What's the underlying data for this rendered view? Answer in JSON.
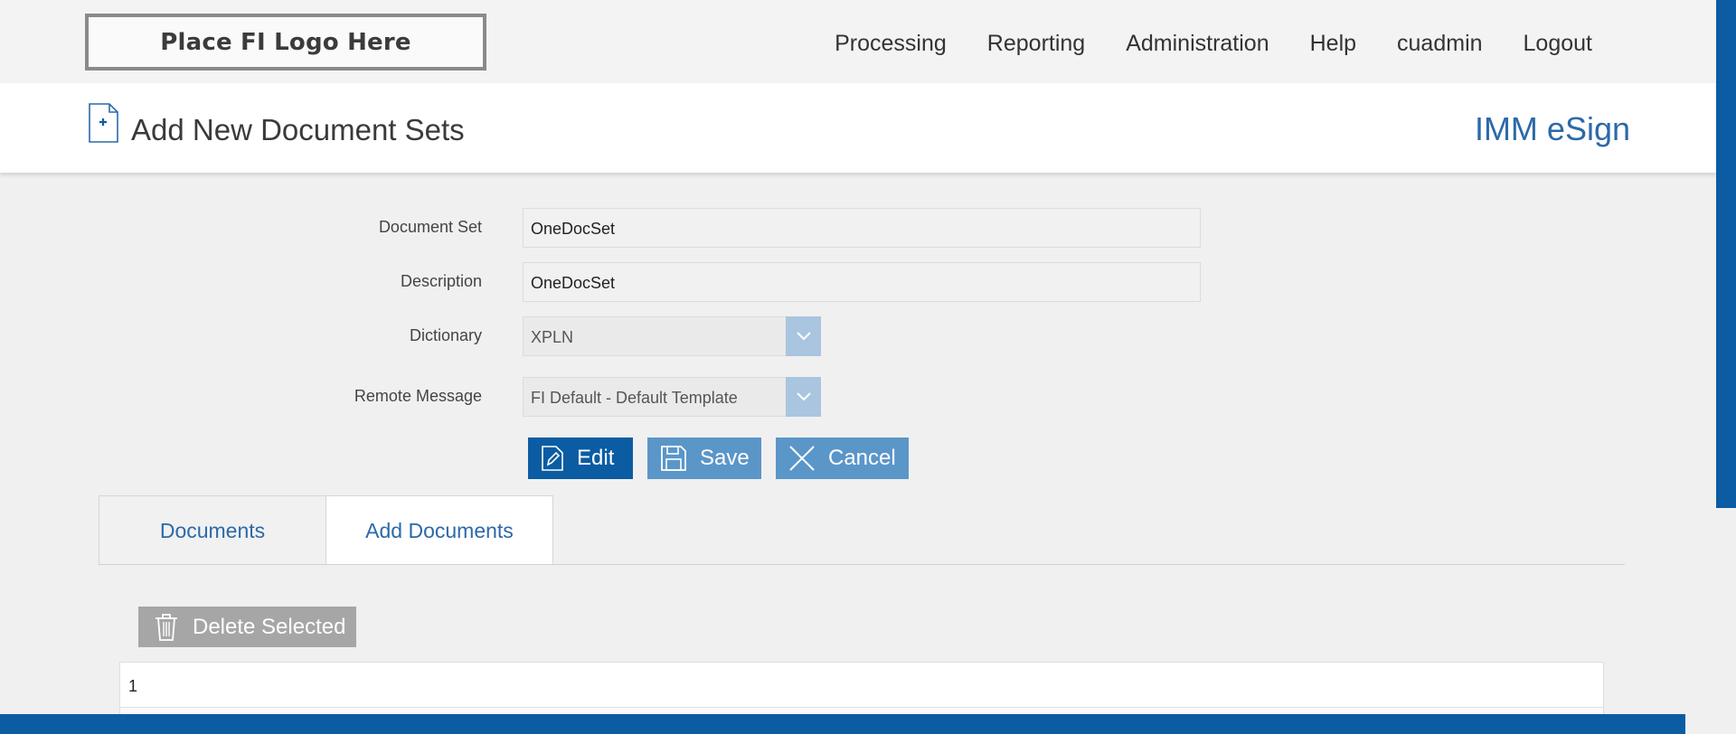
{
  "header": {
    "logo_text": "Place FI Logo Here",
    "nav": [
      "Processing",
      "Reporting",
      "Administration",
      "Help",
      "cuadmin",
      "Logout"
    ]
  },
  "titlebar": {
    "title": "Add New Document Sets",
    "brand": "IMM eSign",
    "icon": "add-document-icon"
  },
  "form": {
    "document_set": {
      "label": "Document Set",
      "value": "OneDocSet"
    },
    "description": {
      "label": "Description",
      "value": "OneDocSet"
    },
    "dictionary": {
      "label": "Dictionary",
      "value": "XPLN"
    },
    "remote_message": {
      "label": "Remote Message",
      "value": "FI Default - Default Template"
    }
  },
  "actions": {
    "edit": "Edit",
    "save": "Save",
    "cancel": "Cancel"
  },
  "tabs": [
    {
      "label": "Documents",
      "active": false
    },
    {
      "label": "Add Documents",
      "active": true
    }
  ],
  "table": {
    "delete_label": "Delete Selected",
    "rows": [
      {
        "cell": "1"
      }
    ]
  },
  "colors": {
    "primary": "#0b5ca3",
    "secondary": "#5b96c9",
    "brand_text": "#2c69a9",
    "disabled": "#a6a6a6"
  }
}
